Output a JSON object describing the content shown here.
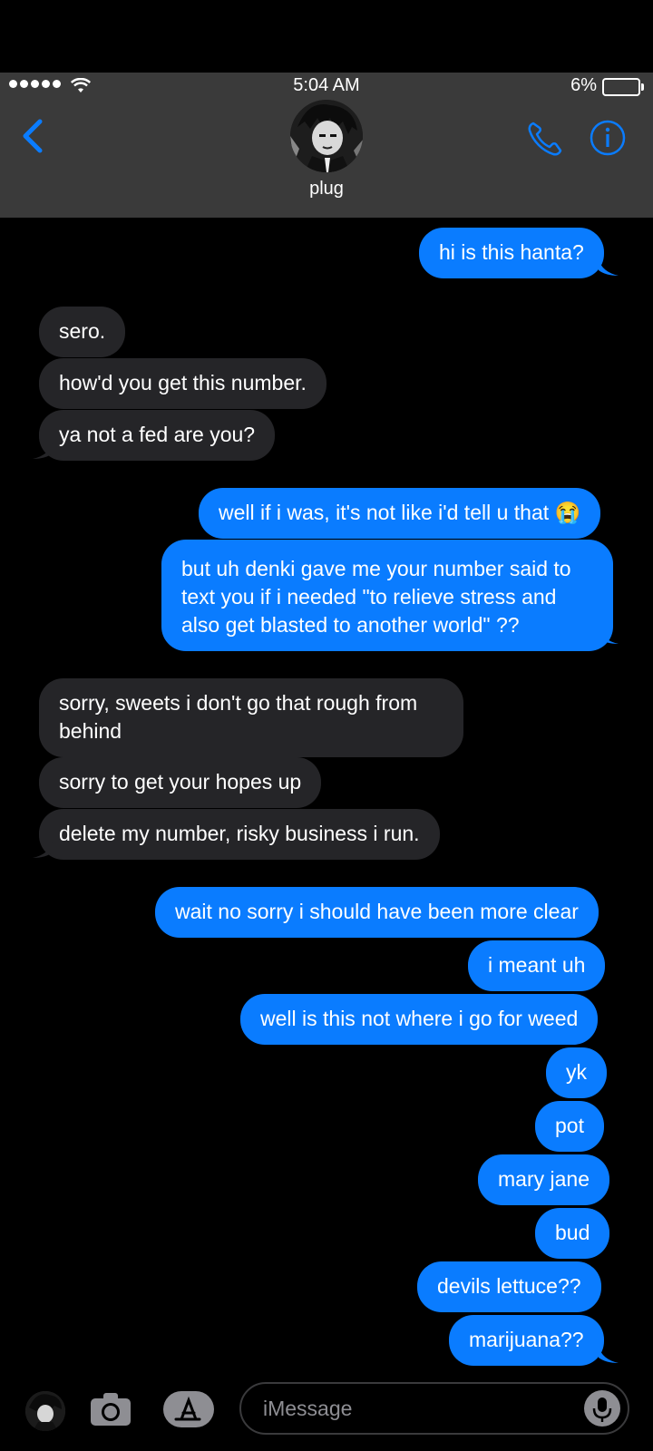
{
  "status": {
    "time": "5:04 AM",
    "battery": "6%"
  },
  "header": {
    "contact": "plug",
    "avatar": "avatar-icon"
  },
  "messages": [
    {
      "from": "me",
      "text": "hi is this hanta?"
    },
    {
      "from": "them",
      "text": "sero."
    },
    {
      "from": "them",
      "text": "how'd you get this number."
    },
    {
      "from": "them",
      "text": "ya not a fed are you?"
    },
    {
      "from": "me",
      "text": "well if i was, it's not like i'd tell u that 😭"
    },
    {
      "from": "me",
      "text": "but uh denki gave me your number said to text you if i needed \"to relieve stress and also get blasted to another world\" ??"
    },
    {
      "from": "them",
      "text": "sorry, sweets i don't go that rough from behind"
    },
    {
      "from": "them",
      "text": "sorry to get your hopes up"
    },
    {
      "from": "them",
      "text": "delete my number, risky business i run."
    },
    {
      "from": "me",
      "text": "wait no sorry i should have been more clear"
    },
    {
      "from": "me",
      "text": "i meant uh"
    },
    {
      "from": "me",
      "text": "well is this not where i go for weed"
    },
    {
      "from": "me",
      "text": "yk"
    },
    {
      "from": "me",
      "text": "pot"
    },
    {
      "from": "me",
      "text": "mary jane"
    },
    {
      "from": "me",
      "text": "bud"
    },
    {
      "from": "me",
      "text": "devils lettuce??"
    },
    {
      "from": "me",
      "text": "marijuana??"
    }
  ],
  "composer": {
    "placeholder": "iMessage"
  },
  "colors": {
    "sent": "#0a7cff",
    "received": "#252528",
    "accent": "#0a7cff"
  }
}
